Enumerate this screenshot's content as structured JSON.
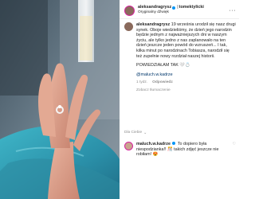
{
  "header": {
    "username": "aleksandragrysz",
    "separator": "|",
    "collaborator": "tomektylicki",
    "verified": "verified-badge-icon",
    "audio": "Oryginalny dźwięk",
    "more": "more-options-icon"
  },
  "caption": {
    "username": "aleksandragrysz",
    "text": "19 września urodził się nasz drugi synek. Obojе wiedzieliśmy, że dzień jego narodzin będzie jednym z najważniejszych dni w naszym życiu, ale tylko jedno z nas zaplanowało na ten dzień jeszcze jeden powód do wzruszeń... I tak, kilka minut po narodzinach Tobiasza, narodził się też zupełnie nowy rozdział naszej historii.",
    "shout": "POWIEDZIAŁAM TAK",
    "emojis": "🤍💍",
    "mention": "@maluch.w.kadrze",
    "time": "1 tydz.",
    "reply": "Odpowiedz",
    "translation": "Zobacz tłumaczenie"
  },
  "divider_label": "Dla Ciebie",
  "comment": {
    "username": "maluch.w.kadrze",
    "text": "To dopiero była niespodzianka!! 🎊 takich zdjęć jeszcze nie robiłam! 😍"
  },
  "colors": {
    "accent": "#0095f6",
    "muted": "#8e8e8e",
    "ring": "#d6249f"
  }
}
